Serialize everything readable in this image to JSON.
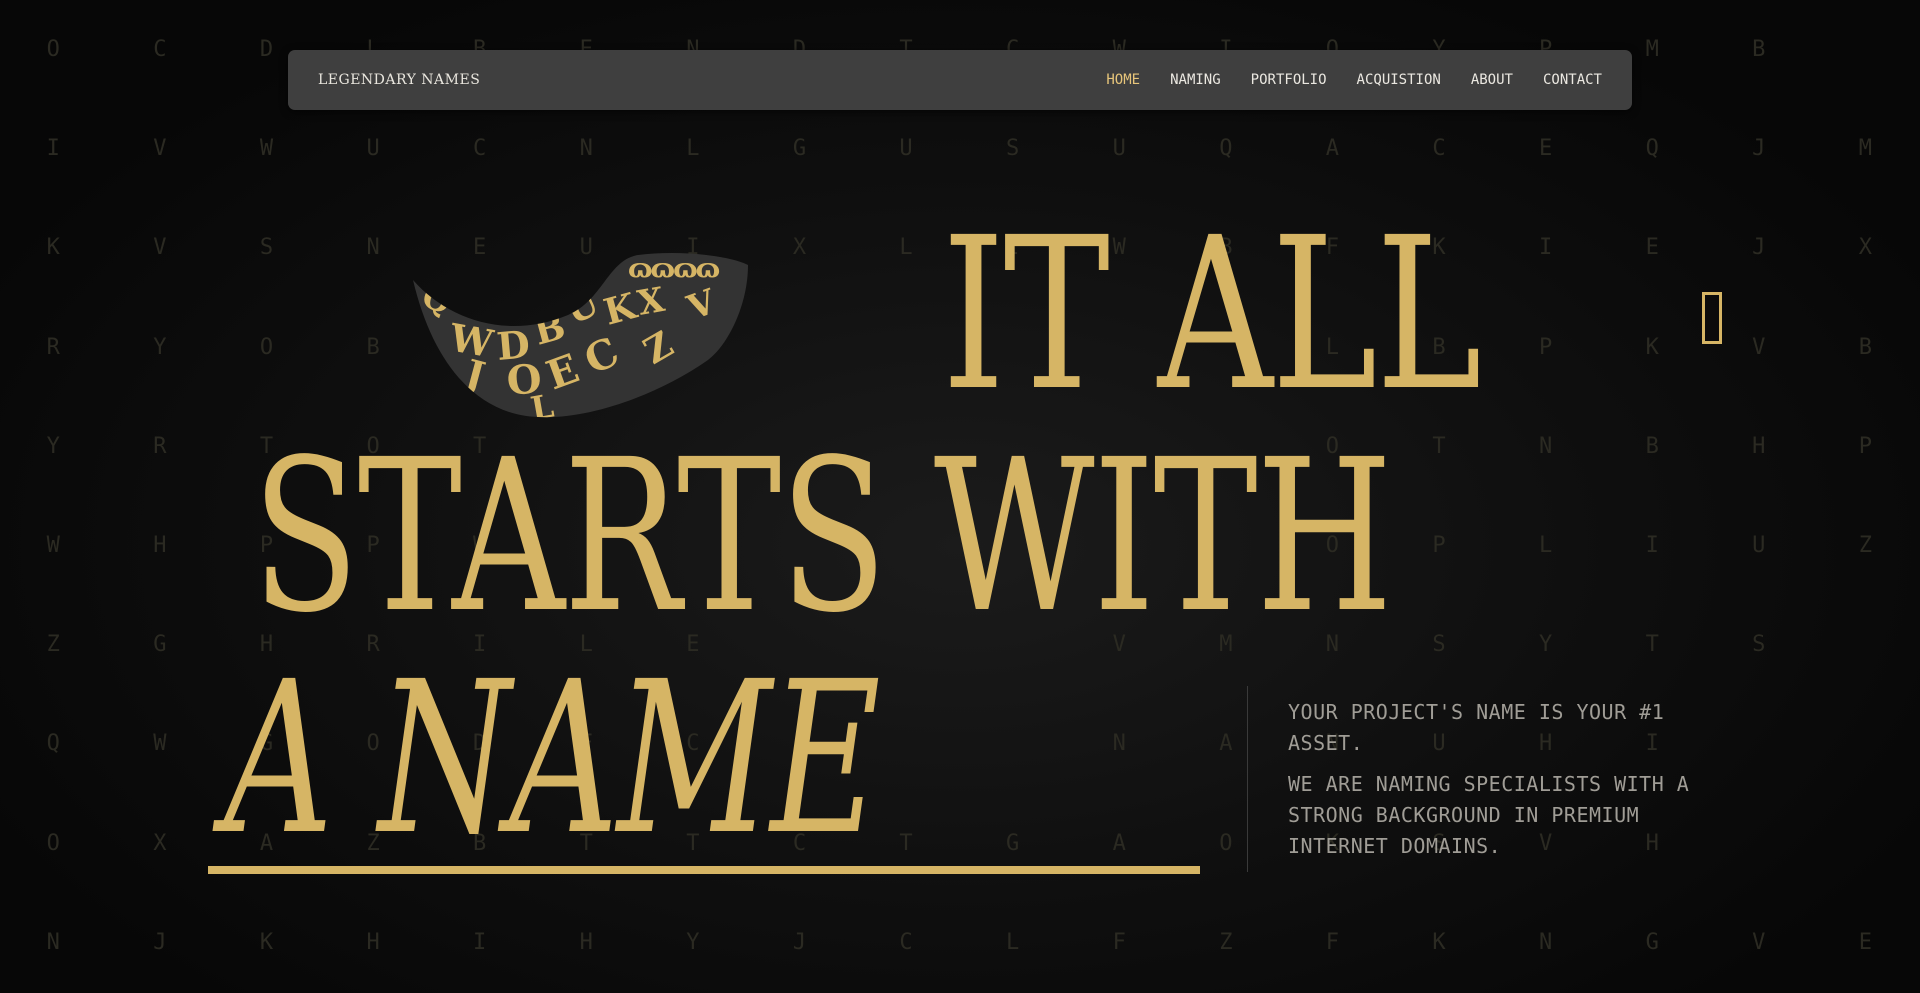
{
  "nav": {
    "brand": "LEGENDARY NAMES",
    "links": [
      "HOME",
      "NAMING",
      "PORTFOLIO",
      "ACQUISTION",
      "ABOUT",
      "CONTACT"
    ],
    "active": "HOME"
  },
  "hero": {
    "line1": "IT ALL",
    "line2": "STARTS WITH",
    "line3": "A NAME",
    "tagline1": "YOUR PROJECT'S NAME IS YOUR #1 ASSET.",
    "tagline2": "WE ARE NAMING SPECIALISTS WITH A STRONG BACKGROUND IN PREMIUM INTERNET DOMAINS."
  },
  "horn_letters": [
    "Q",
    "W",
    "D",
    "B",
    "U",
    "J",
    "O",
    "K",
    "X",
    "V",
    "E",
    "C",
    "L",
    "Z"
  ],
  "background_letters": [
    "O",
    "C",
    "D",
    "L",
    "B",
    "E",
    "N",
    "D",
    "T",
    "C",
    "W",
    "I",
    "O",
    "Y",
    "P",
    "M",
    "B",
    "",
    "I",
    "V",
    "W",
    "U",
    "C",
    "N",
    "L",
    "G",
    "U",
    "S",
    "U",
    "Q",
    "A",
    "C",
    "E",
    "Q",
    "J",
    "M",
    "K",
    "V",
    "S",
    "N",
    "E",
    "U",
    "I",
    "X",
    "L",
    "I",
    "W",
    "B",
    "F",
    "K",
    "I",
    "E",
    "J",
    "X",
    "R",
    "Y",
    "O",
    "B",
    "",
    "",
    "",
    "",
    "",
    "",
    "",
    "",
    "L",
    "B",
    "P",
    "K",
    "V",
    "B",
    "Y",
    "R",
    "T",
    "O",
    "T",
    "",
    "",
    "",
    "",
    "",
    "",
    "",
    "O",
    "T",
    "N",
    "B",
    "H",
    "P",
    "W",
    "H",
    "P",
    "P",
    "W",
    "",
    "",
    "",
    "",
    "",
    "",
    "",
    "O",
    "P",
    "L",
    "I",
    "U",
    "Z",
    "Z",
    "G",
    "H",
    "R",
    "I",
    "L",
    "E",
    "",
    "",
    "",
    "V",
    "M",
    "N",
    "S",
    "Y",
    "T",
    "S",
    "",
    "Q",
    "W",
    "G",
    "O",
    "D",
    "F",
    "C",
    "",
    "",
    "",
    "N",
    "A",
    "N",
    "U",
    "H",
    "I",
    "",
    "",
    "O",
    "X",
    "A",
    "Z",
    "B",
    "T",
    "T",
    "C",
    "T",
    "G",
    "A",
    "O",
    "K",
    "S",
    "V",
    "H",
    "",
    "",
    "N",
    "J",
    "K",
    "H",
    "I",
    "H",
    "Y",
    "J",
    "C",
    "L",
    "F",
    "Z",
    "F",
    "K",
    "N",
    "G",
    "V",
    "E"
  ],
  "colors": {
    "accent": "#d6b565",
    "nav_bg": "#3f3f3f",
    "page_bg": "#060606"
  }
}
